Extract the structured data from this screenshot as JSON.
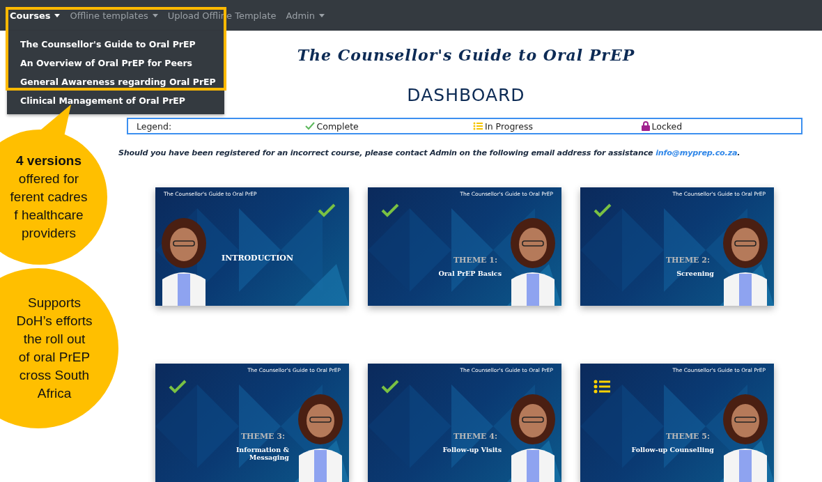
{
  "navbar": {
    "items": [
      {
        "label": "Courses",
        "selected": true,
        "dropdown": true
      },
      {
        "label": "Offline templates",
        "selected": false,
        "dropdown": true
      },
      {
        "label": "Upload Offline Template",
        "selected": false,
        "dropdown": false
      },
      {
        "label": "Admin",
        "selected": false,
        "dropdown": true
      }
    ]
  },
  "courses_menu": {
    "items": [
      "The Counsellor's Guide to Oral PrEP",
      "An Overview of Oral PrEP for Peers",
      "General Awareness regarding Oral PrEP",
      "Clinical Management of Oral PrEP"
    ]
  },
  "course_title": "The Counsellor's Guide to Oral PrEP",
  "heading": "DASHBOARD",
  "legend": {
    "label": "Legend:",
    "items": [
      {
        "kind": "complete",
        "label": "Complete"
      },
      {
        "kind": "in_progress",
        "label": "In Progress"
      },
      {
        "kind": "locked",
        "label": "Locked"
      }
    ]
  },
  "notice": {
    "text": "Should you have been registered for an incorrect course, please contact Admin on the following email address for assistance",
    "email": "info@myprep.co.za",
    "end": "."
  },
  "modules": [
    {
      "header": "The Counsellor's Guide to Oral PrEP",
      "title": "INTRODUCTION",
      "kind": "complete"
    },
    {
      "header": "The Counsellor's Guide to Oral PrEP",
      "theme": "THEME 1:",
      "title": "Oral PrEP Basics",
      "kind": "complete"
    },
    {
      "header": "The Counsellor's Guide to Oral PrEP",
      "theme": "THEME 2:",
      "title": "Screening",
      "kind": "complete"
    },
    {
      "header": "The Counsellor's Guide to Oral PrEP",
      "theme": "THEME 3:",
      "title": "Information & Messaging",
      "kind": "complete"
    },
    {
      "header": "The Counsellor's Guide to Oral PrEP",
      "theme": "THEME 4:",
      "title": "Follow-up Visits",
      "kind": "complete"
    },
    {
      "header": "The Counsellor's Guide to Oral PrEP",
      "theme": "THEME 5:",
      "title": "Follow-up Counselling",
      "kind": "in_progress"
    }
  ],
  "callouts": [
    {
      "lines": [
        "**4 versions**",
        "offered for",
        "ferent cadres",
        "f healthcare",
        "providers"
      ],
      "pointer": true
    },
    {
      "lines": [
        "Supports",
        "DoH’s efforts",
        "the roll out",
        "of oral PrEP",
        "cross South",
        "Africa"
      ],
      "pointer": false
    }
  ]
}
